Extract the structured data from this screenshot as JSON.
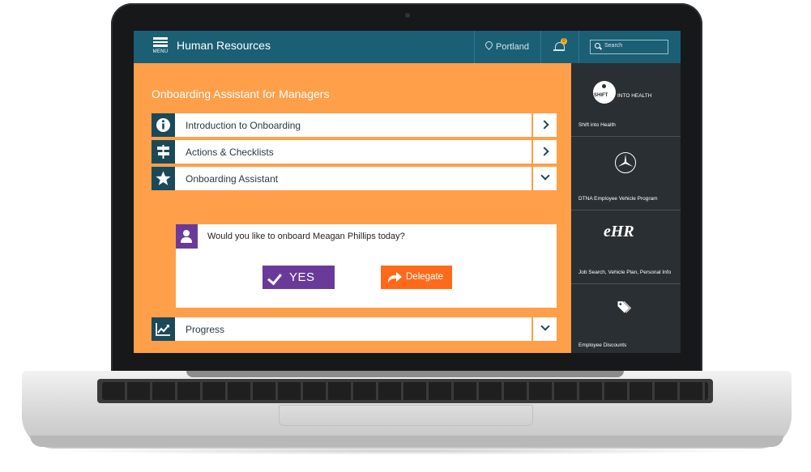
{
  "header": {
    "menu_label": "MENU",
    "title": "Human Resources",
    "location": "Portland",
    "notification_count": "0",
    "search_placeholder": "Search"
  },
  "main": {
    "title": "Onboarding Assistant for Managers",
    "sections": [
      {
        "label": "Introduction to Onboarding",
        "icon": "info-icon",
        "state": "collapsed"
      },
      {
        "label": "Actions & Checklists",
        "icon": "signpost-icon",
        "state": "collapsed"
      },
      {
        "label": "Onboarding Assistant",
        "icon": "star-icon",
        "state": "expanded"
      },
      {
        "label": "Progress",
        "icon": "trend-chart-icon",
        "state": "collapsed"
      }
    ],
    "assistant": {
      "question": "Would you like to onboard Meagan Phillips today?",
      "yes_label": "YES",
      "delegate_label": "Delegate"
    }
  },
  "sidebar": {
    "items": [
      {
        "logo_text_a": "SHIFT",
        "logo_text_b": "INTO HEALTH",
        "caption": "Shift into Health",
        "icon": "shift-into-health-logo"
      },
      {
        "caption": "DTNA Employee Vehicle Program",
        "icon": "mercedes-star-icon"
      },
      {
        "logo_text": "eHR",
        "caption": "Job Search, Vehicle Plan, Personal Info",
        "icon": "ehr-logo"
      },
      {
        "caption": "Employee Discounts",
        "icon": "price-tags-icon"
      }
    ]
  },
  "colors": {
    "header_bg": "#1b5f74",
    "main_bg": "#ff9f4a",
    "icon_bg": "#1a4a5a",
    "yes_button": "#6a3a9a",
    "delegate_button": "#ff6a1a",
    "sidebar_bg": "#2a2f33"
  }
}
